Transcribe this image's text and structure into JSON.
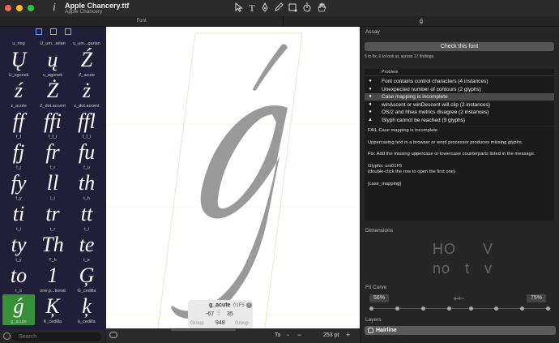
{
  "window": {
    "title": "Apple Chancery.ttf",
    "subtitle": "Apple Chancery",
    "app_icon": "i"
  },
  "tabs": {
    "font": "Font",
    "glyph": "ǵ"
  },
  "sidebar": {
    "header_names": [
      "u_ring",
      "U_um...arian",
      "u_um...garian"
    ],
    "cells": [
      {
        "glyph": "Ų",
        "name": "U_ogonek"
      },
      {
        "glyph": "ų",
        "name": "u_ogonek"
      },
      {
        "glyph": "Ź",
        "name": "Z_acute"
      },
      {
        "glyph": "ź",
        "name": "z_acute"
      },
      {
        "glyph": "Ż",
        "name": "Z_dot.accent"
      },
      {
        "glyph": "ż",
        "name": "z_dot.accent"
      },
      {
        "glyph": "ff",
        "name": "f_f"
      },
      {
        "glyph": "ffi",
        "name": "f_f_i"
      },
      {
        "glyph": "ffl",
        "name": "f_f_l"
      },
      {
        "glyph": "fj",
        "name": "f_j"
      },
      {
        "glyph": "fr",
        "name": "f_r"
      },
      {
        "glyph": "fu",
        "name": "f_u"
      },
      {
        "glyph": "fy",
        "name": "f_y"
      },
      {
        "glyph": "ll",
        "name": "l_l"
      },
      {
        "glyph": "th",
        "name": "t_h"
      },
      {
        "glyph": "ti",
        "name": "t_i"
      },
      {
        "glyph": "tr",
        "name": "t_r"
      },
      {
        "glyph": "tt",
        "name": "t_t"
      },
      {
        "glyph": "ty",
        "name": "t_y"
      },
      {
        "glyph": "Th",
        "name": "T_h"
      },
      {
        "glyph": "te",
        "name": "t_e"
      },
      {
        "glyph": "to",
        "name": "t_o"
      },
      {
        "glyph": "1",
        "name": "one.p...tional"
      },
      {
        "glyph": "Ģ",
        "name": "G_cedilla"
      },
      {
        "glyph": "ǵ",
        "name": "g_acute",
        "selected": true
      },
      {
        "glyph": "Ķ",
        "name": "K_cedilla"
      },
      {
        "glyph": "ķ",
        "name": "k_cedilla"
      }
    ],
    "search_placeholder": "Search"
  },
  "canvas": {
    "glyph_char": "ǵ",
    "glyph_name": "g_acute",
    "unicode": "01F5",
    "lsb": "-67",
    "rsb": "35",
    "advance": "948",
    "left_group": "Group",
    "right_group": "Group",
    "zoom": "253 pt",
    "zoom_minus": "−",
    "zoom_plus": "+",
    "preview_label": "To"
  },
  "assay": {
    "title": "Assay",
    "check_button": "Check this font",
    "summary": "5 to fix, 6 to look at, across 17 findings.",
    "column_header": "Problem",
    "problems": [
      {
        "icon": "●",
        "text": "Font contains control characters  (4 instances)"
      },
      {
        "icon": "●",
        "text": "Unexpected number of contours  (2 glyphs)"
      },
      {
        "icon": "●",
        "text": "Case mapping is incomplete",
        "selected": true
      },
      {
        "icon": "●",
        "text": "winAscent or winDescent will clip  (2 instances)"
      },
      {
        "icon": "●",
        "text": "OS/2 and hhea metrics disagree  (2 instances)"
      },
      {
        "icon": "▲",
        "text": "Glyph cannot be reached  (9 glyphs)"
      }
    ],
    "detail": {
      "heading": "FAIL  Case mapping is incomplete",
      "line1": "Uppercasing text in a browser or word processor produces missing glyphs.",
      "line2": "Fix: Add the missing uppercase or lowercase counterparts listed in the message.",
      "line3": "Glyphs: uni01F5",
      "line4": "(double-click the row to open the first one)",
      "line5": "[case_mapping]"
    }
  },
  "dimensions": {
    "title": "Dimensions",
    "sample_top": "HO",
    "sample_top_right": "V",
    "sample_bottom": "no",
    "sample_bottom_mid": "t",
    "sample_bottom_right": "v"
  },
  "fit_curve": {
    "title": "Fit Curve",
    "left_value": "56%",
    "right_value": "75%"
  },
  "layers": {
    "title": "Layers",
    "items": [
      "Hairline"
    ]
  },
  "colors": {
    "selection_green": "#3a8f3a",
    "sidebar_bg": "#1f1f3a",
    "glyph_gray": "#999999"
  }
}
